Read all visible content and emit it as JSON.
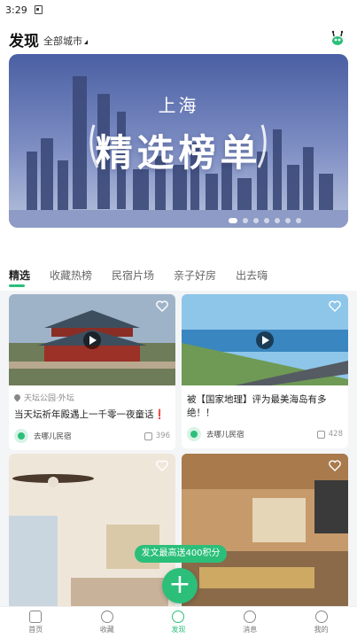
{
  "status_bar": {
    "time": "3:29"
  },
  "header": {
    "title": "发现",
    "city": "全部城市"
  },
  "banner": {
    "city": "上海",
    "headline": "精选榜单",
    "dot_count": 7,
    "active_dot": 0
  },
  "tabs": [
    {
      "label": "精选",
      "active": true
    },
    {
      "label": "收藏热榜",
      "active": false
    },
    {
      "label": "民宿片场",
      "active": false
    },
    {
      "label": "亲子好房",
      "active": false
    },
    {
      "label": "出去嗨",
      "active": false
    }
  ],
  "cards": [
    {
      "location": "天坛公园·外坛",
      "text": "当天坛祈年殿遇上一千零一夜童话❗",
      "author": "去哪儿民宿",
      "likes": "396",
      "has_video": true
    },
    {
      "location": "",
      "text": "被【国家地理】评为最美海岛有多绝！！",
      "author": "去哪儿民宿",
      "likes": "428",
      "has_video": true
    },
    {
      "location": "",
      "text": "",
      "author": "",
      "likes": "",
      "has_video": false
    },
    {
      "location": "",
      "text": "",
      "author": "",
      "likes": "",
      "has_video": false
    }
  ],
  "promo": {
    "label": "发文最高送400积分"
  },
  "fab": {
    "label": "+"
  },
  "bottom_nav": [
    {
      "label": "首页",
      "icon": "home-icon",
      "active": false
    },
    {
      "label": "收藏",
      "icon": "heart-icon",
      "active": false
    },
    {
      "label": "发现",
      "icon": "compass-icon",
      "active": true
    },
    {
      "label": "消息",
      "icon": "chat-icon",
      "active": false
    },
    {
      "label": "我的",
      "icon": "user-icon",
      "active": false
    }
  ],
  "colors": {
    "accent": "#2bbf7a",
    "banner_sky": "#5d6fb0"
  }
}
